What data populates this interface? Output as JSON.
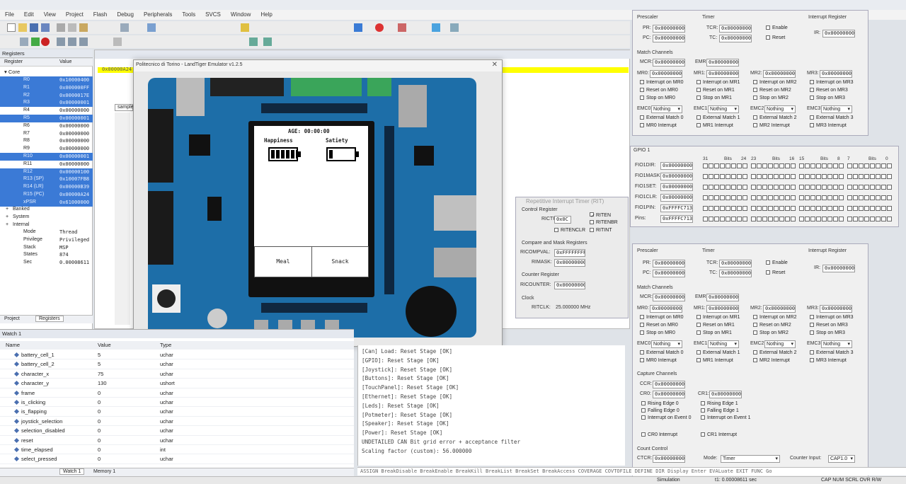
{
  "menu": [
    "File",
    "Edit",
    "View",
    "Project",
    "Flash",
    "Debug",
    "Peripherals",
    "Tools",
    "SVCS",
    "Window",
    "Help"
  ],
  "registers_panel": {
    "title": "Registers",
    "col_register": "Register",
    "col_value": "Value",
    "core_label": "Core",
    "rows": [
      {
        "name": "R0",
        "value": "0x10000400",
        "hl": true
      },
      {
        "name": "R1",
        "value": "0x000000FF",
        "hl": true
      },
      {
        "name": "R2",
        "value": "0x0000017E",
        "hl": true
      },
      {
        "name": "R3",
        "value": "0x00000001",
        "hl": true
      },
      {
        "name": "R4",
        "value": "0x00000000",
        "hl": false
      },
      {
        "name": "R5",
        "value": "0x00000001",
        "hl": true
      },
      {
        "name": "R6",
        "value": "0x00000000",
        "hl": false
      },
      {
        "name": "R7",
        "value": "0x00000000",
        "hl": false
      },
      {
        "name": "R8",
        "value": "0x00000000",
        "hl": false
      },
      {
        "name": "R9",
        "value": "0x00000000",
        "hl": false
      },
      {
        "name": "R10",
        "value": "0x00000001",
        "hl": true
      },
      {
        "name": "R11",
        "value": "0x00000000",
        "hl": false
      },
      {
        "name": "R12",
        "value": "0x00000100",
        "hl": true
      },
      {
        "name": "R13 (SP)",
        "value": "0x10007FB8",
        "hl": true
      },
      {
        "name": "R14 (LR)",
        "value": "0x00000B39",
        "hl": true
      },
      {
        "name": "R15 (PC)",
        "value": "0x00000A24",
        "hl": true
      },
      {
        "name": "xPSR",
        "value": "0x61000000",
        "hl": true
      }
    ],
    "groups": [
      "Banked",
      "System",
      "Internal"
    ],
    "internal": [
      {
        "name": "Mode",
        "value": "Thread"
      },
      {
        "name": "Privilege",
        "value": "Privileged"
      },
      {
        "name": "Stack",
        "value": "MSP"
      },
      {
        "name": "States",
        "value": "874"
      },
      {
        "name": "Sec",
        "value": "0.00008611"
      }
    ],
    "tabs": [
      "Project",
      "Registers"
    ]
  },
  "watch": {
    "title": "Watch 1",
    "col_name": "Name",
    "col_value": "Value",
    "col_type": "Type",
    "rows": [
      {
        "name": "battery_cell_1",
        "value": "5",
        "type": "uchar"
      },
      {
        "name": "battery_cell_2",
        "value": "5",
        "type": "uchar"
      },
      {
        "name": "character_x",
        "value": "75",
        "type": "uchar"
      },
      {
        "name": "character_y",
        "value": "130",
        "type": "ushort"
      },
      {
        "name": "frame",
        "value": "0",
        "type": "uchar"
      },
      {
        "name": "is_clicking",
        "value": "0",
        "type": "uchar"
      },
      {
        "name": "is_flapping",
        "value": "0",
        "type": "uchar"
      },
      {
        "name": "joystick_selection",
        "value": "0",
        "type": "uchar"
      },
      {
        "name": "selection_disabled",
        "value": "0",
        "type": "uchar"
      },
      {
        "name": "reset",
        "value": "0",
        "type": "uchar"
      },
      {
        "name": "time_elapsed",
        "value": "0",
        "type": "int"
      },
      {
        "name": "select_pressed",
        "value": "0",
        "type": "uchar"
      }
    ],
    "tabs": [
      "Watch 1",
      "Memory 1"
    ]
  },
  "editor": {
    "tab": "sample",
    "highlight_line": "0x00000A24"
  },
  "emulator": {
    "title": "Politecnico di Torino - LandTiger Emulator v1.2.5",
    "lcd": {
      "age_label": "AGE: 00:00:00",
      "happiness_label": "Happiness",
      "satiety_label": "Satiety",
      "happiness_level": 1.0,
      "satiety_level": 0.2,
      "meal_label": "Meal",
      "snack_label": "Snack"
    }
  },
  "rit_panel": {
    "title": "Repetitive Interrupt Timer (RIT)",
    "control_title": "Control Register",
    "ritctrl_label": "RICTRL:",
    "ritctrl": "0x0C",
    "riten_label": "RITEN",
    "ritenbr_label": "RITENBR",
    "ritenclr_label": "RITENCLR",
    "ritint_label": "RITINT",
    "compare_title": "Compare and Mask Registers",
    "ricompval_label": "RICOMPVAL:",
    "ricompval": "0xFFFFFFFF",
    "rimask_label": "RIMASK:",
    "rimask": "0x00000000",
    "counter_title": "Counter Register",
    "ricounter_label": "RICOUNTER:",
    "ricounter": "0x00000000",
    "clock_title": "Clock",
    "ritclk_label": "RITCLK:",
    "ritclk": "25.000000 MHz"
  },
  "timer_top": {
    "prescaler_title": "Prescaler",
    "timer_title": "Timer",
    "interrupt_title": "Interrupt Register",
    "pr_label": "PR:",
    "pr": "0x00000000",
    "pc_label": "PC:",
    "pc": "0x00000000",
    "tcr_label": "TCR:",
    "tcr": "0x00000000",
    "tc_label": "TC:",
    "tc": "0x00000000",
    "enable": "Enable",
    "reset": "Reset",
    "ir_label": "IR:",
    "ir": "0x00000000",
    "match_title": "Match Channels",
    "mcr_label": "MCR:",
    "mcr": "0x00000000",
    "emr_label": "EMR:",
    "emr": "0x00000000",
    "mr": [
      {
        "label": "MR0:",
        "value": "0x00000000",
        "n": "0"
      },
      {
        "label": "MR1:",
        "value": "0x00000000",
        "n": "1"
      },
      {
        "label": "MR2:",
        "value": "0x00000000",
        "n": "2"
      },
      {
        "label": "MR3:",
        "value": "0x00000000",
        "n": "3"
      }
    ],
    "emc_labels": [
      "EMC0:",
      "EMC1:",
      "EMC2:",
      "EMC3:"
    ],
    "emc_value": "Nothing"
  },
  "gpio": {
    "title": "GPIO 1",
    "rows": [
      {
        "label": "FIO1DIR:",
        "value": "0x00000000"
      },
      {
        "label": "FIO1MASK:",
        "value": "0x00000000"
      },
      {
        "label": "FIO1SET:",
        "value": "0x00000000"
      },
      {
        "label": "FIO1CLR:",
        "value": "0x00000000"
      },
      {
        "label": "FIO1PIN:",
        "value": "0xFFFFC713"
      },
      {
        "label": "Pins:",
        "value": "0xFFFFC713"
      }
    ],
    "bits_header": [
      "31",
      "Bits",
      "24",
      "23",
      "Bits",
      "16",
      "15",
      "Bits",
      "8",
      "7",
      "Bits",
      "0"
    ]
  },
  "timer_bottom": {
    "prescaler_title": "Prescaler",
    "timer_title": "Timer",
    "interrupt_title": "Interrupt Register",
    "pr_label": "PR:",
    "pr": "0x00000000",
    "pc_label": "PC:",
    "pc": "0x00000000",
    "tcr_label": "TCR:",
    "tcr": "0x00000000",
    "tc_label": "TC:",
    "tc": "0x00000000",
    "enable": "Enable",
    "reset": "Reset",
    "ir_label": "IR:",
    "ir": "0x00000000",
    "match_title": "Match Channels",
    "mcr_label": "MCR:",
    "mcr": "0x00000000",
    "emr_label": "EMR:",
    "emr": "0x00000000",
    "mr": [
      {
        "label": "MR0:",
        "value": "0x00000000",
        "n": "0"
      },
      {
        "label": "MR1:",
        "value": "0x00000000",
        "n": "1"
      },
      {
        "label": "MR2:",
        "value": "0x00000000",
        "n": "2"
      },
      {
        "label": "MR3:",
        "value": "0x00000000",
        "n": "3"
      }
    ],
    "emc_labels": [
      "EMC0:",
      "EMC1:",
      "EMC2:",
      "EMC3:"
    ],
    "emc_value": "Nothing",
    "capture_title": "Capture Channels",
    "ccr_label": "CCR:",
    "ccr": "0x00000000",
    "cr0_label": "CR0:",
    "cr0": "0x00000000",
    "cr1_label": "CR1:",
    "cr1": "0x00000000",
    "rising0": "Rising Edge 0",
    "falling0": "Falling Edge 0",
    "int0": "Interrupt on Event 0",
    "rising1": "Rising Edge 1",
    "falling1": "Falling Edge 1",
    "int1": "Interrupt on Event 1",
    "cr0int": "CR0 Interrupt",
    "cr1int": "CR1 Interrupt",
    "count_title": "Count Control",
    "ctcr_label": "CTCR:",
    "ctcr": "0x00000000",
    "mode_label": "Mode:",
    "mode": "Timer",
    "counter_input_label": "Counter Input:",
    "counter_input": "CAP1.0"
  },
  "console": {
    "lines": [
      "[Can] Load: Reset Stage [OK]",
      "[GPIO]: Reset Stage [OK]",
      "[Joystick]: Reset Stage [OK]",
      "[Buttons]: Reset Stage [OK]",
      "[TouchPanel]: Reset Stage [OK]",
      "[Ethernet]: Reset Stage [OK]",
      "[Leds]: Reset Stage [OK]",
      "[Potmeter]: Reset Stage [OK]",
      "[Speaker]: Reset Stage [OK]",
      "[Power]: Reset Stage [OK]",
      "UNDETAILED CAN Bit grid error + acceptance filter",
      "Scaling factor (custom): 56.000000"
    ],
    "command_line": "ASSIGN BreakDisable BreakEnable BreakKill BreakList BreakSet BreakAccess COVERAGE COVTOFILE DEFINE DIR Display Enter EVALuate EXIT FUNC Go"
  },
  "status": {
    "simulation": "Simulation",
    "time": "t1: 0.00008611 sec",
    "caps": "CAP NUM SCRL OVR R/W"
  },
  "colors": {
    "board": "#1d6ea8",
    "highlight": "#3b7ad6",
    "yellow_line": "#ffff00"
  }
}
